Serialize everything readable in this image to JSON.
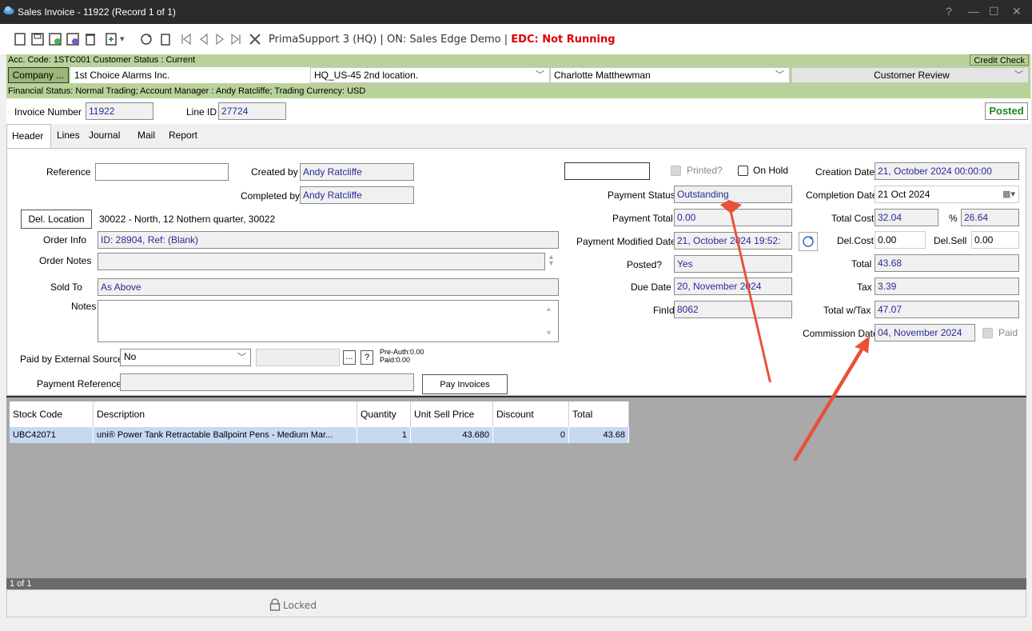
{
  "window": {
    "title": "Sales Invoice - 11922  (Record 1 of 1)",
    "controls": [
      "?",
      "—",
      "☐",
      "✕"
    ]
  },
  "toolbar": {
    "support": "PrimaSupport 3 (HQ)",
    "separator": " | ",
    "connection": "ON: Sales Edge Demo",
    "edc": "EDC: Not Running"
  },
  "account": {
    "text": "Acc. Code: 1STC001  Customer Status : Current",
    "credit_check": "Credit Check"
  },
  "company": {
    "button": "Company ...",
    "name": "1st Choice Alarms Inc.",
    "location": "HQ_US-45 2nd location.",
    "contact": "Charlotte Matthewman",
    "review": "Customer Review"
  },
  "financial": {
    "text": "Financial Status: Normal Trading;  Account Manager : Andy Ratcliffe;  Trading Currency: USD"
  },
  "invoice": {
    "number_label": "Invoice Number",
    "number": "11922",
    "line_label": "Line ID",
    "line_id": "27724",
    "status": "Posted"
  },
  "tabs": [
    "Header",
    "Lines",
    "Journal",
    "Mail",
    "Report"
  ],
  "header": {
    "reference_label": "Reference",
    "reference": "",
    "created_by_label": "Created by",
    "created_by": "Andy Ratcliffe",
    "completed_by_label": "Completed by",
    "completed_by": "Andy Ratcliffe",
    "del_location_button": "Del. Location",
    "del_location": "30022 - North, 12 Nothern quarter, 30022",
    "order_info_label": "Order Info",
    "order_info": "ID: 28904, Ref: (Blank)",
    "order_notes_label": "Order Notes",
    "order_notes": "",
    "sold_to_label": "Sold To",
    "sold_to": "As Above",
    "notes_label": "Notes",
    "notes": "",
    "paid_external_label": "Paid by External Source",
    "paid_external": "No",
    "ellipsis_button": "...",
    "help_button": "?",
    "pre_auth": "Pre-Auth:0.00",
    "paid": "Paid:0.00",
    "payment_reference_label": "Payment Reference",
    "payment_reference": "",
    "pay_invoices_button": "Pay Invoices",
    "printed_label": "Printed?",
    "on_hold_label": "On Hold",
    "payment_status_label": "Payment Status",
    "payment_status": "Outstanding",
    "payment_total_label": "Payment Total",
    "payment_total": "0.00",
    "payment_modified_label": "Payment Modified Date",
    "payment_modified": "21, October 2024  19:52:",
    "posted_label": "Posted?",
    "posted": "Yes",
    "due_date_label": "Due Date",
    "due_date": "20, November 2024",
    "finid_label": "FinId",
    "finid": "8062",
    "creation_date_label": "Creation Date",
    "creation_date": "21, October 2024  00:00:00",
    "completion_date_label": "Completion Date",
    "completion_date": "21 Oct 2024",
    "total_cost_label": "Total Cost",
    "total_cost": "32.04",
    "percent_label": "%",
    "percent": "26.64",
    "del_cost_label": "Del.Cost",
    "del_cost": "0.00",
    "del_sell_label": "Del.Sell",
    "del_sell": "0.00",
    "total_label": "Total",
    "total": "43.68",
    "tax_label": "Tax",
    "tax": "3.39",
    "total_wtax_label": "Total w/Tax",
    "total_wtax": "47.07",
    "commission_date_label": "Commission Date",
    "commission_date": "04, November 2024",
    "paid_label": "Paid"
  },
  "lines": {
    "columns": [
      "Stock Code",
      "Description",
      "Quantity",
      "Unit Sell Price",
      "Discount",
      "Total"
    ],
    "rows": [
      [
        "UBC42071",
        "uni® Power Tank Retractable Ballpoint Pens - Medium Mar...",
        "1",
        "43.680",
        "0",
        "43.68"
      ]
    ]
  },
  "status": {
    "record": "1 of 1",
    "locked": "Locked"
  },
  "colors": {
    "green_band": "#b8d29a",
    "posted_green": "#1b8a1b",
    "edc_red": "#e00000",
    "field_text": "#2a2a9a",
    "arrow": "#e8503a"
  }
}
